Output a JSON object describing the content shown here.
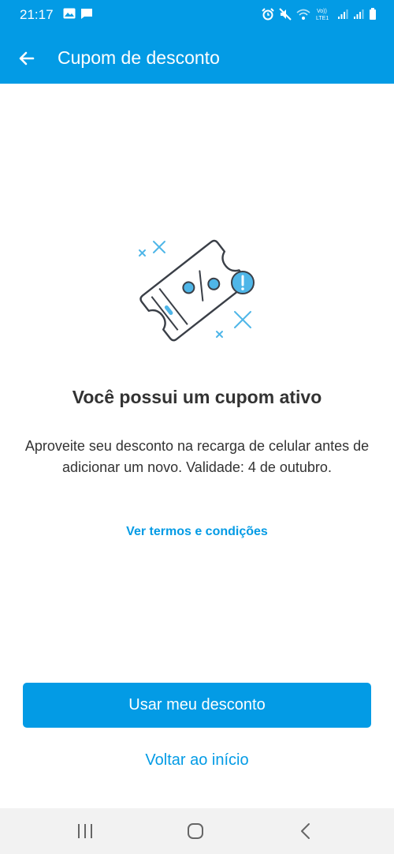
{
  "status_bar": {
    "time": "21:17",
    "left_icons": [
      "image-icon",
      "message-icon"
    ],
    "right_icons": [
      "alarm-icon",
      "mute-icon",
      "wifi-icon",
      "volte-icon",
      "signal-icon",
      "signal-icon",
      "battery-icon"
    ],
    "network_label": "Vo))\nLTE1"
  },
  "app_bar": {
    "back_icon": "arrow-left-icon",
    "title": "Cupom de desconto"
  },
  "content": {
    "illustration_icon": "coupon-ticket-icon",
    "headline": "Você possui um cupom ativo",
    "body": "Aproveite seu desconto na recarga de celular antes de adicionar um novo. Validade: 4 de outubro.",
    "terms_link": "Ver termos e condições"
  },
  "actions": {
    "primary": "Usar meu desconto",
    "secondary": "Voltar ao início"
  },
  "nav_bar": {
    "buttons": [
      "recent-apps-icon",
      "home-icon",
      "back-icon"
    ]
  },
  "colors": {
    "brand": "#039be5",
    "text": "#333333",
    "nav_bg": "#f2f2f2"
  }
}
